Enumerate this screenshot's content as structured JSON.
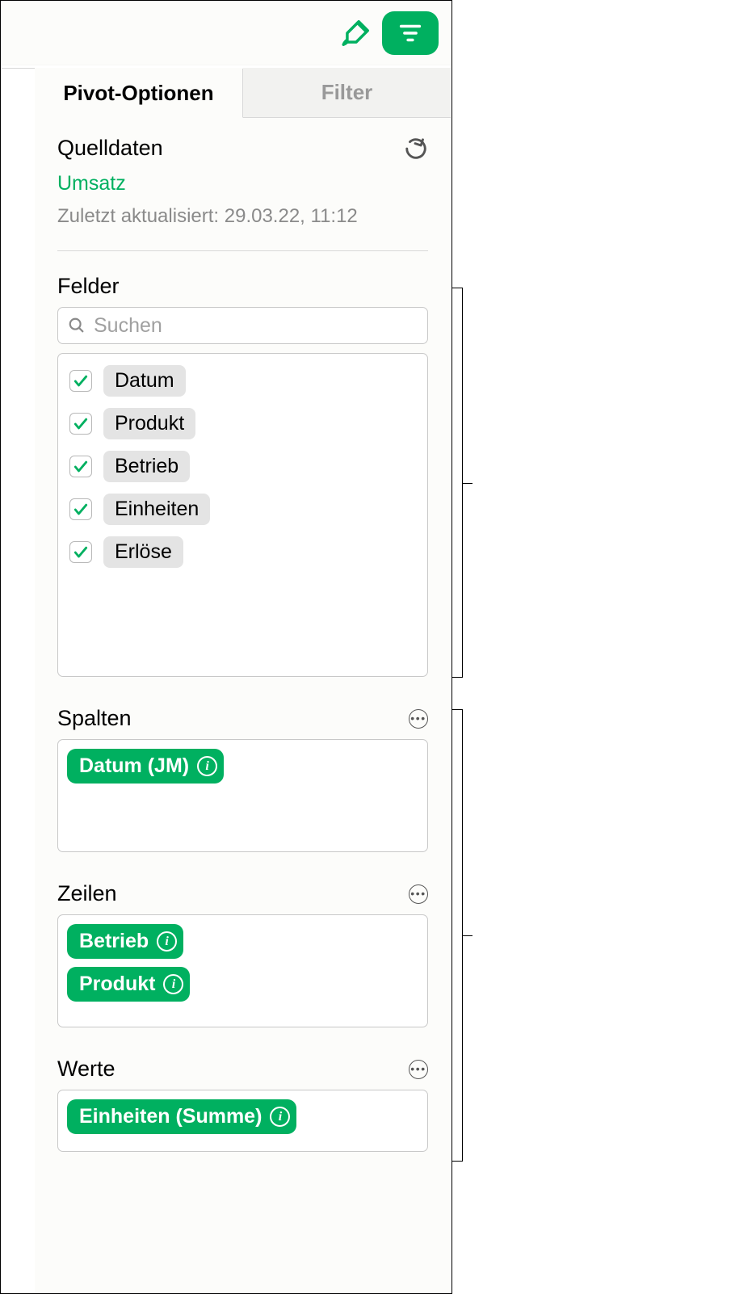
{
  "tabs": {
    "pivot": "Pivot-Optionen",
    "filter": "Filter"
  },
  "source": {
    "title": "Quelldaten",
    "name": "Umsatz",
    "updated": "Zuletzt aktualisiert: 29.03.22, 11:12"
  },
  "fields": {
    "label": "Felder",
    "search_placeholder": "Suchen",
    "items": [
      {
        "label": "Datum"
      },
      {
        "label": "Produkt"
      },
      {
        "label": "Betrieb"
      },
      {
        "label": "Einheiten"
      },
      {
        "label": "Erlöse"
      }
    ]
  },
  "columns": {
    "label": "Spalten",
    "chips": [
      {
        "label": "Datum (JM)"
      }
    ]
  },
  "rows": {
    "label": "Zeilen",
    "chips": [
      {
        "label": "Betrieb"
      },
      {
        "label": "Produkt"
      }
    ]
  },
  "values": {
    "label": "Werte",
    "chips": [
      {
        "label": "Einheiten (Summe)"
      }
    ]
  }
}
